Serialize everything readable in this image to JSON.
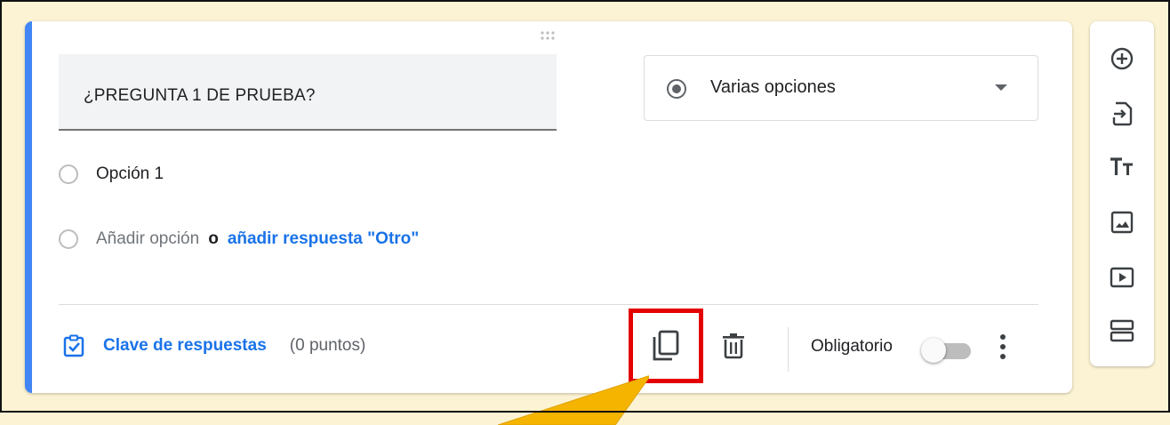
{
  "question": {
    "title": "¿PREGUNTA 1 DE PRUEBA?",
    "type": "Varias opciones"
  },
  "options": [
    {
      "label": "Opción 1"
    }
  ],
  "add_option": {
    "label": "Añadir opción",
    "or": "o",
    "other_link": "añadir respuesta \"Otro\""
  },
  "footer": {
    "answer_key": "Clave de respuestas",
    "points": "(0 puntos)",
    "required_label": "Obligatorio",
    "required": false
  },
  "icons": {
    "drag": "drag-handle-icon",
    "radio": "radio-checked-icon",
    "duplicate": "duplicate-icon",
    "delete": "trash-icon",
    "more": "more-vert-icon",
    "answer_key": "checklist-icon"
  },
  "sidebar": [
    {
      "icon": "add-circle-icon"
    },
    {
      "icon": "import-icon"
    },
    {
      "icon": "title-icon"
    },
    {
      "icon": "image-icon"
    },
    {
      "icon": "video-icon"
    },
    {
      "icon": "section-icon"
    }
  ],
  "colors": {
    "accent": "#4285f4",
    "link": "#1a73e8",
    "highlight": "#e50000",
    "background": "#fbf3d3",
    "callout": "#f4b400"
  }
}
